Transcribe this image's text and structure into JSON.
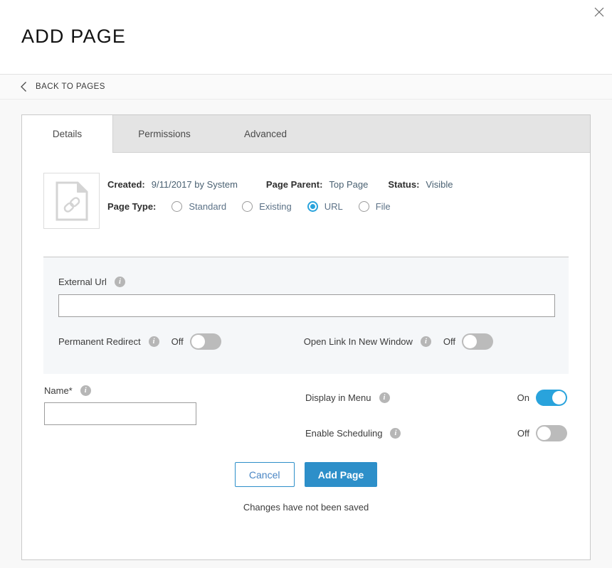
{
  "header": {
    "title": "ADD PAGE",
    "close_icon": "close-icon"
  },
  "breadcrumb": {
    "back_icon": "chevron-left-icon",
    "label": "BACK TO PAGES"
  },
  "tabs": [
    {
      "label": "Details",
      "active": true
    },
    {
      "label": "Permissions",
      "active": false
    },
    {
      "label": "Advanced",
      "active": false
    }
  ],
  "thumbnail": {
    "icon": "document-link-icon"
  },
  "meta": {
    "created_label": "Created:",
    "created_value": "9/11/2017 by System",
    "page_parent_label": "Page Parent:",
    "page_parent_value": "Top Page",
    "status_label": "Status:",
    "status_value": "Visible",
    "page_type_label": "Page Type:",
    "page_type_options": [
      {
        "label": "Standard",
        "checked": false
      },
      {
        "label": "Existing",
        "checked": false
      },
      {
        "label": "URL",
        "checked": true
      },
      {
        "label": "File",
        "checked": false
      }
    ]
  },
  "external_url": {
    "label": "External Url",
    "info_icon": "info-icon",
    "value": "",
    "placeholder": ""
  },
  "panel_toggles": [
    {
      "label": "Permanent Redirect",
      "info_icon": "info-icon",
      "state": "Off",
      "on": false
    },
    {
      "label": "Open Link In New Window",
      "info_icon": "info-icon",
      "state": "Off",
      "on": false
    }
  ],
  "name_field": {
    "label": "Name*",
    "info_icon": "info-icon",
    "value": "",
    "placeholder": ""
  },
  "right_toggles": [
    {
      "label": "Display in Menu",
      "info_icon": "info-icon",
      "state": "On",
      "on": true
    },
    {
      "label": "Enable Scheduling",
      "info_icon": "info-icon",
      "state": "Off",
      "on": false
    }
  ],
  "actions": {
    "cancel_label": "Cancel",
    "submit_label": "Add Page"
  },
  "status_message": "Changes have not been saved",
  "colors": {
    "accent_blue": "#29a3dc",
    "button_blue": "#2d8fc9",
    "panel_gray": "#f5f7f9",
    "tabstrip_gray": "#e4e4e4",
    "toggle_off_gray": "#bbbbbb"
  }
}
